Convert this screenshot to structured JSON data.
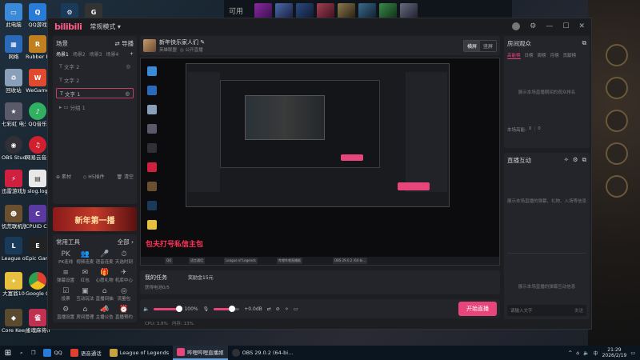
{
  "desktop": {
    "top_label": "可用",
    "icons_left": [
      "此电脑",
      "网络",
      "回收站",
      "七彩虹 电光炸裂! ZERO",
      "OBS Studio",
      "迅雷游戏加速器",
      "饥荒联机版",
      "League of Legends",
      "大富翁10",
      "Core Keeper 地心..."
    ],
    "icons_right": [
      "QQ游戏",
      "Rubber Bandits",
      "WeGame",
      "QQ音乐",
      "网易云音乐",
      "slog.log",
      "CPUID CPU-Z",
      "Epic Games Launcher",
      "Google Chrome",
      "雀魂麻将(Mahjong..."
    ],
    "top_icons": [
      "steam-icon",
      "logitech-icon"
    ]
  },
  "app": {
    "logo": "bilibili",
    "mode": "常规模式",
    "window_controls": [
      "avatar",
      "settings",
      "minimize",
      "maximize",
      "close"
    ]
  },
  "scenes": {
    "title": "场景",
    "import": "导播",
    "tabs": [
      "场景1",
      "场景2",
      "场景3",
      "场景4"
    ],
    "sources": [
      "文字 2",
      "文字 2",
      "文字 1"
    ],
    "group": "分组 1",
    "bottom": [
      "素材",
      "H5插件",
      "清空"
    ]
  },
  "ad": {
    "text": "新年第一播"
  },
  "tools": {
    "title": "常用工具",
    "more": "全部",
    "items": [
      "PK连线",
      "视频连麦",
      "语音连麦",
      "天选时刻",
      "弹幕设置",
      "红包",
      "心愿礼物",
      "机库中心",
      "投票",
      "互动玩法",
      "直播间抽",
      "流量包",
      "直播设置",
      "房间管理",
      "主播公告",
      "直播预约"
    ]
  },
  "stream": {
    "title": "新年快乐家人们",
    "category": "英雄联盟",
    "visibility": "公开直播",
    "orientation": [
      "横屏",
      "竖屏"
    ],
    "active_orientation": "横屏"
  },
  "preview": {
    "overlay_text": "包夫打号私信主包",
    "mini_taskbar": [
      "QQ",
      "语言通话",
      "League of Legends",
      "哔哩哔哩直播姬",
      "OBS 29.0.2 (64-bi..."
    ]
  },
  "task": {
    "title": "我的任务",
    "subtitle": "获得电池0/5",
    "reward": "奖励金15元"
  },
  "audio": {
    "speaker_level": "100%",
    "speaker_fraction": 1.0,
    "mic_level": "+0.0dB",
    "mic_fraction": 0.7,
    "start_button": "开始直播"
  },
  "status": {
    "cpu": "CPU: 3.8%",
    "memory": "内存: 13%"
  },
  "rank": {
    "title": "房间观众",
    "tabs": [
      "高能榜",
      "日榜",
      "周榜",
      "月榜",
      "贡献榜"
    ],
    "active_tab": "高能榜",
    "empty": "展示本场直播期间的观众排名",
    "footer_label": "本场高能:",
    "footer_values": [
      "0",
      "0"
    ]
  },
  "interact": {
    "title": "直播互动",
    "empty_top": "展示本场直播的弹幕、礼物、入场等信息",
    "empty_bottom": "展示本场直播的弹幕互动信息",
    "input_placeholder": "请输入文字",
    "send": "发送"
  },
  "taskbar": {
    "apps": [
      "QQ",
      "语音通话",
      "League of Legends",
      "哔哩哔哩直播姬",
      "OBS 29.0.2 (64-bi..."
    ],
    "time": "21:29",
    "date": "2026/2/19"
  },
  "colors": {
    "accent": "#e8457a",
    "panel": "#24252b",
    "window": "#1d1e22"
  }
}
